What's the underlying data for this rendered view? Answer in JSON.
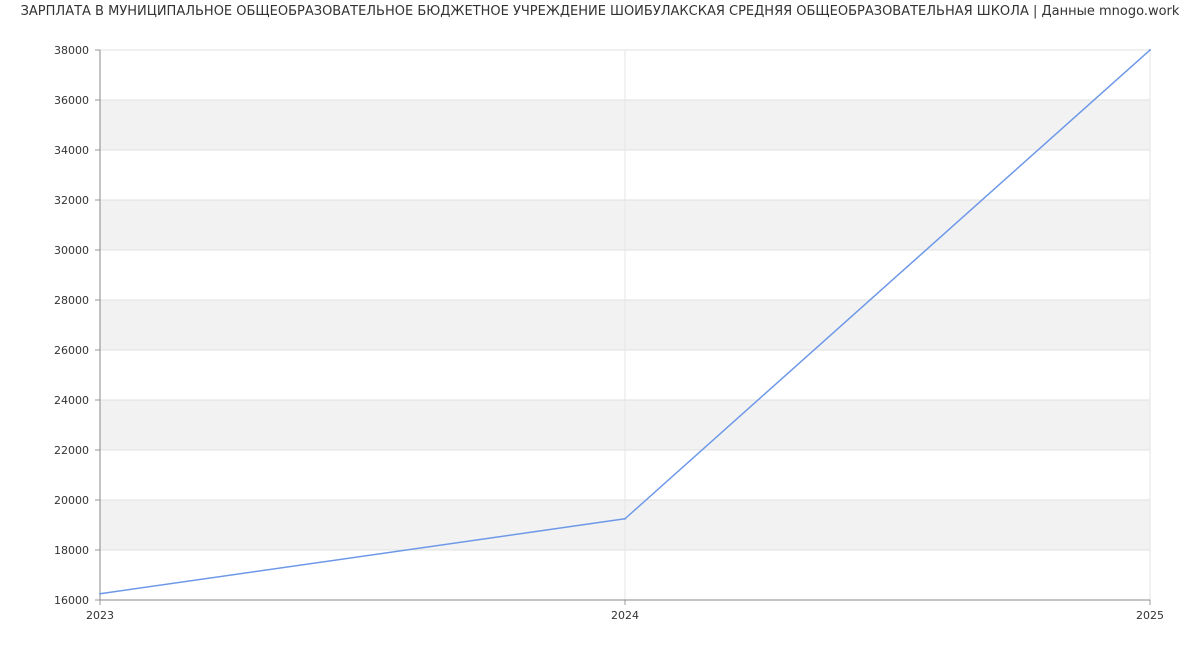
{
  "chart_data": {
    "type": "line",
    "title": "ЗАРПЛАТА В МУНИЦИПАЛЬНОЕ ОБЩЕОБРАЗОВАТЕЛЬНОЕ БЮДЖЕТНОЕ УЧРЕЖДЕНИЕ ШОЙБУЛАКСКАЯ СРЕДНЯЯ ОБЩЕОБРАЗОВАТЕЛЬНАЯ ШКОЛА | Данные mnogo.work",
    "xlabel": "",
    "ylabel": "",
    "x": [
      "2023",
      "2024",
      "2025"
    ],
    "series": [
      {
        "values": [
          16250,
          19250,
          38000
        ],
        "color": "#6d98e8"
      }
    ],
    "ylim": [
      16000,
      38000
    ],
    "yticks": [
      "16000",
      "18000",
      "20000",
      "22000",
      "24000",
      "26000",
      "28000",
      "30000",
      "32000",
      "34000",
      "36000",
      "38000"
    ],
    "grid": true,
    "band_color": "#f2f2f2"
  }
}
